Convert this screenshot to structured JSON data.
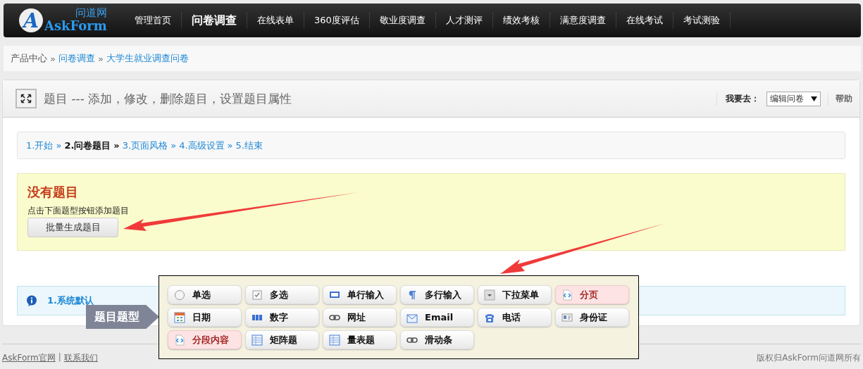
{
  "logo": {
    "name_cn": "问道网",
    "name_en": "AskForm",
    "letter": "A"
  },
  "nav": [
    {
      "label": "管理首页",
      "selected": false
    },
    {
      "label": "问卷调查",
      "selected": true
    },
    {
      "label": "在线表单",
      "selected": false
    },
    {
      "label": "360度评估",
      "selected": false
    },
    {
      "label": "敬业度调查",
      "selected": false
    },
    {
      "label": "人才测评",
      "selected": false
    },
    {
      "label": "绩效考核",
      "selected": false
    },
    {
      "label": "满意度调查",
      "selected": false
    },
    {
      "label": "在线考试",
      "selected": false
    },
    {
      "label": "考试测验",
      "selected": false
    }
  ],
  "breadcrumb": [
    {
      "label": "产品中心",
      "link": false
    },
    {
      "label": "问卷调查",
      "link": true
    },
    {
      "label": "大学生就业调查问卷",
      "link": true
    }
  ],
  "breadcrumb_separator": "»",
  "panel": {
    "title": "题目 --- 添加，修改，删除题目，设置题目属性",
    "goto_label": "我要去：",
    "goto_value": "编辑问卷",
    "help": "帮助"
  },
  "steps": [
    {
      "label": "1.开始",
      "selected": false
    },
    {
      "label": "2.问卷题目",
      "selected": true
    },
    {
      "label": "3.页面风格",
      "selected": false
    },
    {
      "label": "4.高级设置",
      "selected": false
    },
    {
      "label": "5.结束",
      "selected": false
    }
  ],
  "empty_notice": {
    "title": "没有题目",
    "text": "点击下面题型按钮添加题目",
    "button": "批量生成题目"
  },
  "info": {
    "text": "1.系统默认"
  },
  "question_types": {
    "label": "题目题型",
    "items": [
      {
        "label": "单选",
        "kind": "radio",
        "highlighted": false
      },
      {
        "label": "多选",
        "kind": "checkbox",
        "highlighted": false
      },
      {
        "label": "单行输入",
        "kind": "abc",
        "highlighted": false
      },
      {
        "label": "多行输入",
        "kind": "paragraph",
        "highlighted": false
      },
      {
        "label": "下拉菜单",
        "kind": "dropdown",
        "highlighted": false
      },
      {
        "label": "分页",
        "kind": "page",
        "highlighted": true
      },
      {
        "label": "日期",
        "kind": "calendar",
        "highlighted": false
      },
      {
        "label": "数字",
        "kind": "number",
        "highlighted": false
      },
      {
        "label": "网址",
        "kind": "link",
        "highlighted": false
      },
      {
        "label": "Email",
        "kind": "mail",
        "highlighted": false
      },
      {
        "label": "电话",
        "kind": "phone",
        "highlighted": false
      },
      {
        "label": "身份证",
        "kind": "idcard",
        "highlighted": false
      },
      {
        "label": "分段内容",
        "kind": "page",
        "highlighted": true
      },
      {
        "label": "矩阵题",
        "kind": "grid",
        "highlighted": false
      },
      {
        "label": "量表题",
        "kind": "grid",
        "highlighted": false
      },
      {
        "label": "滑动条",
        "kind": "link",
        "highlighted": false
      }
    ]
  },
  "footer": {
    "links": [
      "AskForm官网",
      "联系我们"
    ],
    "separator": "|",
    "copyright": "版权归AskForm问道网所有"
  }
}
